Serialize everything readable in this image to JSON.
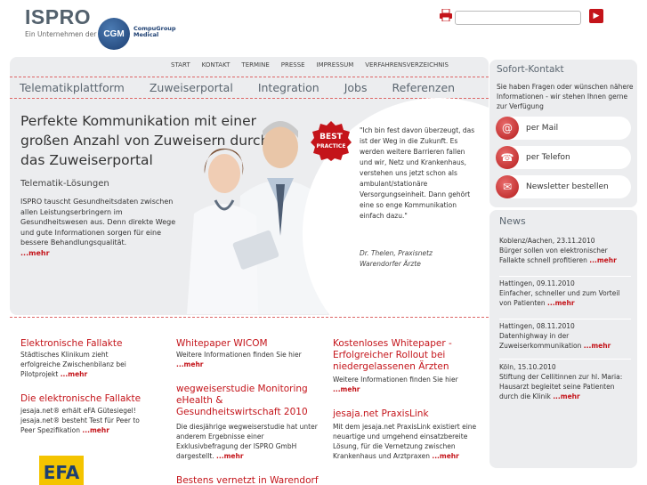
{
  "header": {
    "logo": "ISPRO",
    "logo_sub": "Ein Unternehmen der",
    "cgm_badge": "CGM",
    "cgm_name_1": "CompuGroup",
    "cgm_name_2": "Medical",
    "search_placeholder": "",
    "search_go": "▶"
  },
  "topnav": [
    "START",
    "KONTAKT",
    "TERMINE",
    "PRESSE",
    "IMPRESSUM",
    "VERFAHRENSVERZEICHNIS"
  ],
  "mainnav": [
    "Telematikplattform",
    "Zuweiserportal",
    "Integration",
    "Jobs",
    "Referenzen"
  ],
  "hero": {
    "headline": "Perfekte Kommunikation mit einer großen Anzahl von Zuweisern durch das Zuweiserportal",
    "subhead": "Telematik-Lösungen",
    "intro": "ISPRO tauscht Gesundheitsdaten zwischen allen Leistungserbringern im Gesundheitswesen aus. Denn direkte Wege und gute Informationen sorgen für eine bessere Behandlungsqualität.",
    "more": "...mehr",
    "badge_1": "BEST",
    "badge_2": "PRACTICE",
    "quote": "\"Ich bin fest davon überzeugt, das ist der Weg in die Zukunft. Es werden weitere Barrieren fallen und wir, Netz und Krankenhaus, verstehen uns jetzt schon als ambulant/stationäre Versorgungseinheit. Dann gehört eine so enge Kommunikation einfach dazu.\"",
    "quote_src": "Dr. Thelen, Praxisnetz Warendorfer Ärzte"
  },
  "contact": {
    "title": "Sofort-Kontakt",
    "text": "Sie haben Fragen oder wünschen nähere Informationen - wir stehen Ihnen gerne zur Verfügung",
    "mail": "per Mail",
    "phone": "per Telefon",
    "newsletter": "Newsletter bestellen"
  },
  "news": {
    "title": "News",
    "items": [
      {
        "date": "Koblenz/Aachen, 23.11.2010",
        "text": "Bürger sollen von elektronischer Fallakte schnell profitieren",
        "more": "...mehr"
      },
      {
        "date": "Hattingen, 09.11.2010",
        "text": "Einfacher, schneller und zum Vorteil von Patienten",
        "more": "...mehr"
      },
      {
        "date": "Hattingen, 08.11.2010",
        "text": "Datenhighway in der Zuweiserkommunikation",
        "more": "...mehr"
      },
      {
        "date": "Köln, 15.10.2010",
        "text": "Stiftung der Cellitinnen zur hl. Maria: Hausarzt begleitet seine Patienten durch die Klinik",
        "more": "...mehr"
      }
    ]
  },
  "col1": {
    "h1": "Elektronische Fallakte",
    "t1": "Städtisches Klinikum zieht erfolgreiche Zwischenbilanz bei Pilotprojekt",
    "h2": "Die elektronische Fallakte",
    "t2": "jesaja.net® erhält eFA Gütesiegel! jesaja.net® besteht Test für Peer to Peer Spezifikation",
    "logo": "EFA"
  },
  "col2": {
    "h1": "Whitepaper WICOM",
    "t1": "Weitere Informationen finden Sie hier",
    "h2": "wegweiserstudie Monitoring eHealth & Gesundheitswirtschaft 2010",
    "t2": "Die diesjährige wegweiserstudie hat unter anderem Ergebnisse einer Exklusivbefragung der ISPRO GmbH dargestellt.",
    "h3": "Bestens vernetzt in Warendorf"
  },
  "col3": {
    "h1": "Kostenloses Whitepaper - Erfolgreicher Rollout bei niedergelassenen Ärzten",
    "t1": "Weitere Informationen finden Sie hier",
    "h2": "jesaja.net PraxisLink",
    "t2": "Mit dem jesaja.net PraxisLink existiert eine neuartige und umgehend einsatzbereite Lösung, für die Vernetzung zwischen Krankenhaus und Arztpraxen"
  },
  "colors": {
    "accent": "#c4141a",
    "panel": "#ecedef",
    "nav": "#5b6670"
  }
}
